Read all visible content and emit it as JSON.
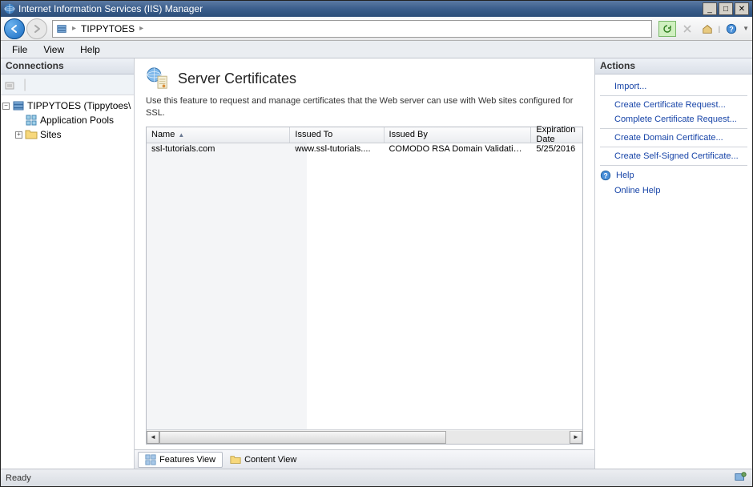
{
  "window": {
    "title": "Internet Information Services (IIS) Manager"
  },
  "breadcrumb": {
    "root_icon": "server-icon",
    "node": "TIPPYTOES"
  },
  "menu": {
    "file": "File",
    "view": "View",
    "help": "Help"
  },
  "connections": {
    "header": "Connections",
    "root": "TIPPYTOES (Tippytoes\\",
    "app_pools": "Application Pools",
    "sites": "Sites"
  },
  "main": {
    "heading": "Server Certificates",
    "description": "Use this feature to request and manage certificates that the Web server can use with Web sites configured for SSL.",
    "columns": {
      "name": "Name",
      "issued_to": "Issued To",
      "issued_by": "Issued By",
      "expiration": "Expiration Date"
    },
    "rows": [
      {
        "name": "ssl-tutorials.com",
        "issued_to": "www.ssl-tutorials....",
        "issued_by": "COMODO RSA Domain Validation...",
        "expiration": "5/25/2016"
      }
    ],
    "tabs": {
      "features": "Features View",
      "content": "Content View"
    }
  },
  "actions": {
    "header": "Actions",
    "import": "Import...",
    "create_req": "Create Certificate Request...",
    "complete_req": "Complete Certificate Request...",
    "create_domain": "Create Domain Certificate...",
    "create_self": "Create Self-Signed Certificate...",
    "help": "Help",
    "online_help": "Online Help"
  },
  "status": {
    "text": "Ready"
  }
}
